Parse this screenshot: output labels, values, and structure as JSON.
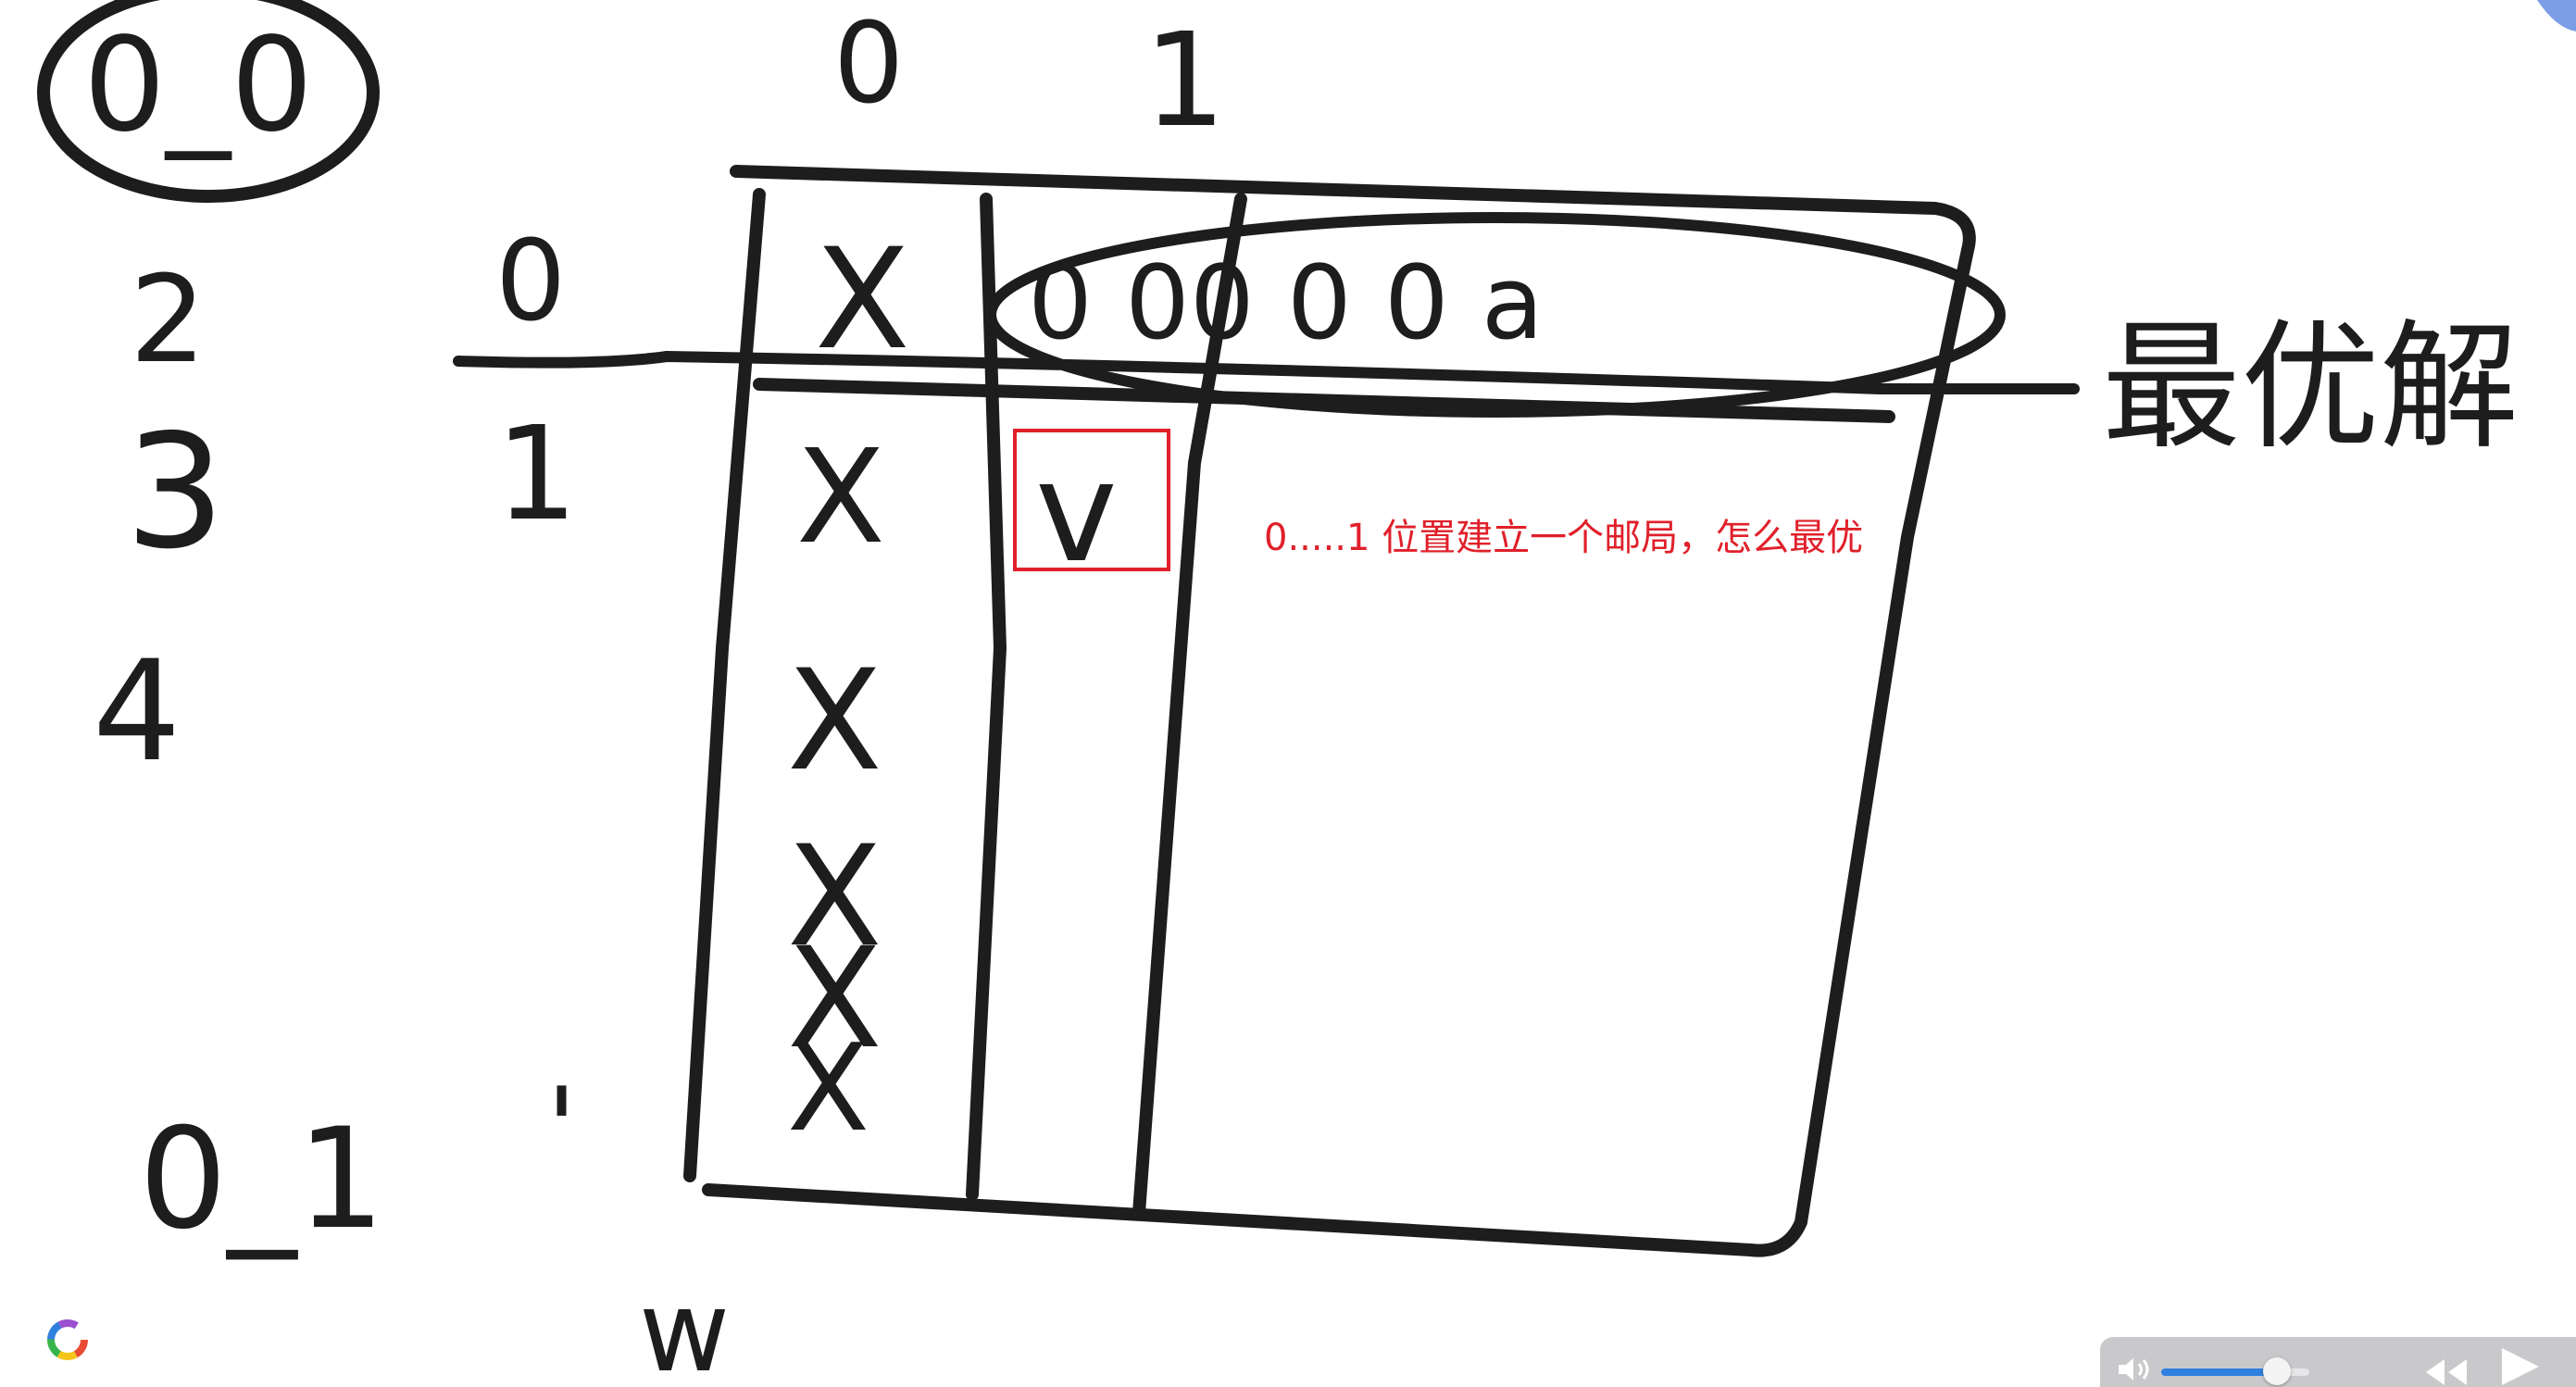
{
  "annotation": {
    "text": "0.....1 位置建立一个邮局，怎么最优",
    "color": "#e0202a"
  },
  "handwriting": {
    "top_left_circled": "0_0",
    "column_headers": [
      "0",
      "1"
    ],
    "row_labels_left": [
      "2",
      "3",
      "4"
    ],
    "row_indices": [
      "0",
      "1"
    ],
    "bottom_left": "0_1",
    "bottom_tick": "'",
    "bottom_mark": "w",
    "cell_marks": [
      "X",
      "X",
      "X",
      "X",
      "X",
      "X"
    ],
    "checked_cell": "v",
    "first_row_values": "0 00 0 0 a",
    "right_label": "最优解"
  },
  "player": {
    "volume_level": 0.78,
    "accent_color": "#2f7fe0",
    "icons": [
      "speaker-icon",
      "rewind-icon",
      "play-icon"
    ]
  },
  "toolbar_icons": [
    "color-wheel-icon",
    "corner-tool-icon"
  ]
}
